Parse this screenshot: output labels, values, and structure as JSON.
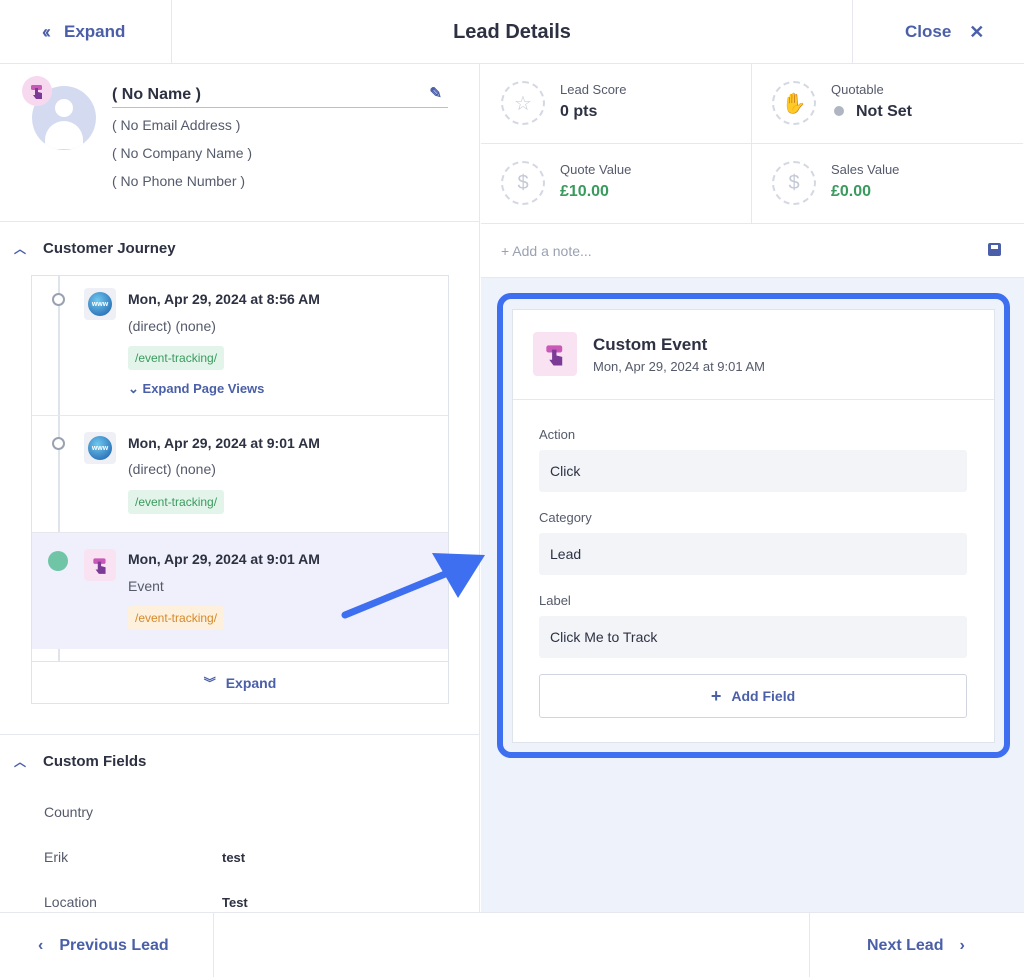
{
  "header": {
    "expand_label": "Expand",
    "title": "Lead Details",
    "close_label": "Close"
  },
  "profile": {
    "name": "( No Name )",
    "email": "( No Email Address )",
    "company": "( No Company Name )",
    "phone": "( No Phone Number )"
  },
  "journey": {
    "heading": "Customer Journey",
    "items": [
      {
        "title": "Mon, Apr 29, 2024 at 8:56 AM",
        "subtitle": "(direct) (none)",
        "tag": "/event-tracking/",
        "icon": "globe-icon",
        "action": "Expand Page Views"
      },
      {
        "title": "Mon, Apr 29, 2024 at 9:01 AM",
        "subtitle": "(direct) (none)",
        "tag": "/event-tracking/",
        "icon": "globe-icon"
      },
      {
        "title": "Mon, Apr 29, 2024 at 9:01 AM",
        "subtitle": "Event",
        "tag": "/event-tracking/",
        "icon": "pointer-hand-icon"
      }
    ],
    "expand_label": "Expand"
  },
  "custom_fields": {
    "heading": "Custom Fields",
    "rows": [
      {
        "label": "Country",
        "value": ""
      },
      {
        "label": "Erik",
        "value": "test"
      },
      {
        "label": "Location",
        "value": "Test"
      }
    ]
  },
  "stats": {
    "lead_score": {
      "label": "Lead Score",
      "value": "0 pts"
    },
    "quotable": {
      "label": "Quotable",
      "value": "Not Set"
    },
    "quote_value": {
      "label": "Quote Value",
      "value": "£10.00"
    },
    "sales_value": {
      "label": "Sales Value",
      "value": "£0.00"
    }
  },
  "note": {
    "placeholder": "+ Add a note..."
  },
  "event_card": {
    "title": "Custom Event",
    "timestamp": "Mon, Apr 29, 2024 at 9:01 AM",
    "fields": [
      {
        "label": "Action",
        "value": "Click"
      },
      {
        "label": "Category",
        "value": "Lead"
      },
      {
        "label": "Label",
        "value": "Click Me to Track"
      }
    ],
    "add_field_label": "Add Field"
  },
  "footer": {
    "prev_label": "Previous Lead",
    "next_label": "Next Lead"
  },
  "colors": {
    "accent": "#4a5fa8",
    "highlight": "#3d6ff0",
    "positive": "#3a9a5e",
    "timeline_active": "#6fc5a6"
  }
}
